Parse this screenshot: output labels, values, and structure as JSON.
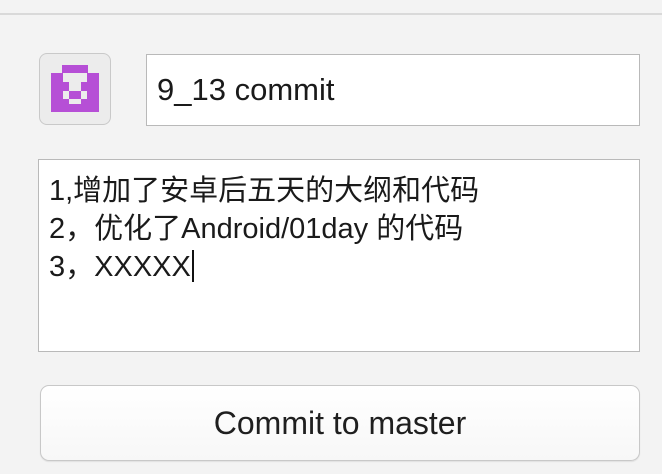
{
  "commit": {
    "summary_value": "9_13 commit",
    "description_lines": [
      "1,增加了安卓后五天的大纲和代码",
      "2，优化了Android/01day 的代码",
      "3，XXXXX"
    ],
    "button_label": "Commit to master"
  },
  "avatar": {
    "icon": "identicon-avatar-icon",
    "color": "#b64fd6",
    "background": "#ececec"
  }
}
